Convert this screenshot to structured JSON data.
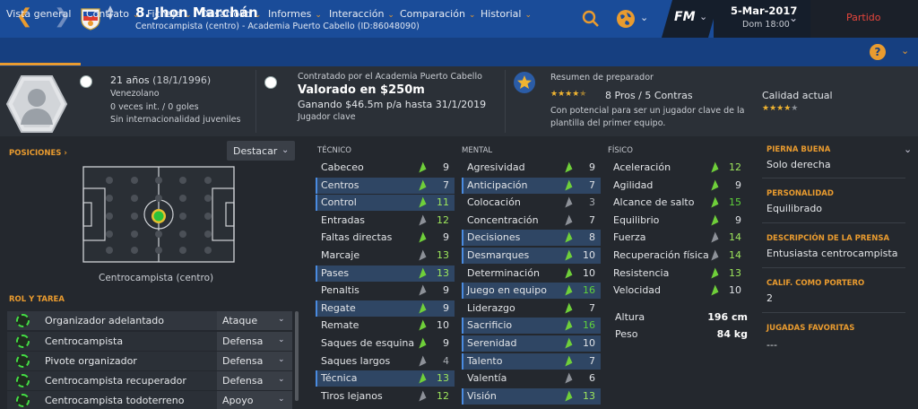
{
  "header": {
    "back_icon": "chevron-left-icon",
    "forward_icon": "chevron-right-icon",
    "title": "8. Jhon Marchán",
    "subtitle": "Centrocampista (centro) - Academia Puerto Cabello (ID:86048090)",
    "search_icon": "search-icon",
    "world_icon": "globe-icon",
    "fm_logo": "FM",
    "date": "5-Mar-2017",
    "time": "Dom 18:00",
    "match_button": "Partido"
  },
  "menu": {
    "items": [
      "Vista general",
      "Contrato",
      "Fichaje",
      "Desarrollo",
      "Informes",
      "Interacción",
      "Comparación",
      "Historial"
    ],
    "help": "?",
    "accent": "#e99b2f"
  },
  "profile": {
    "age": "21 años",
    "dob": "(18/1/1996)",
    "nationality": "Venezolano",
    "caps": "0 veces int. / 0 goles",
    "youth": "Sin internacionalidad juveniles"
  },
  "contract": {
    "signed_by": "Contratado por el Academia Puerto Cabello",
    "value": "Valorado en $250m",
    "wage": "Ganando $46.5m p/a hasta 31/1/2019",
    "status": "Jugador clave"
  },
  "scout": {
    "title": "Resumen de preparador",
    "pros_cons": "8 Pros / 5 Contras",
    "summary_line1": "Con potencial para ser un jugador clave de la",
    "summary_line2": "plantilla del primer equipo.",
    "potential_stars": 4,
    "current_label": "Calidad actual",
    "current_stars": 4
  },
  "positions": {
    "label": "POSICIONES",
    "highlight": "Destacar",
    "position": "Centrocampista (centro)"
  },
  "roles": {
    "label": "ROL Y TAREA",
    "items": [
      {
        "role": "Organizador adelantado",
        "duty": "Ataque"
      },
      {
        "role": "Centrocampista",
        "duty": "Defensa"
      },
      {
        "role": "Pivote organizador",
        "duty": "Defensa"
      },
      {
        "role": "Centrocampista recuperador",
        "duty": "Defensa"
      },
      {
        "role": "Centrocampista todoterreno",
        "duty": "Apoyo"
      }
    ]
  },
  "attributes": {
    "technical_label": "TÉCNICO",
    "mental_label": "MENTAL",
    "physical_label": "FÍSICO",
    "technical": [
      {
        "name": "Cabeceo",
        "value": 9
      },
      {
        "name": "Centros",
        "value": 7
      },
      {
        "name": "Control",
        "value": 11
      },
      {
        "name": "Entradas",
        "value": 12
      },
      {
        "name": "Faltas directas",
        "value": 9
      },
      {
        "name": "Marcaje",
        "value": 13
      },
      {
        "name": "Pases",
        "value": 13
      },
      {
        "name": "Penaltis",
        "value": 9
      },
      {
        "name": "Regate",
        "value": 9
      },
      {
        "name": "Remate",
        "value": 10
      },
      {
        "name": "Saques de esquina",
        "value": 9
      },
      {
        "name": "Saques largos",
        "value": 4
      },
      {
        "name": "Técnica",
        "value": 13
      },
      {
        "name": "Tiros lejanos",
        "value": 12
      }
    ],
    "mental": [
      {
        "name": "Agresividad",
        "value": 9
      },
      {
        "name": "Anticipación",
        "value": 7
      },
      {
        "name": "Colocación",
        "value": 3
      },
      {
        "name": "Concentración",
        "value": 7
      },
      {
        "name": "Decisiones",
        "value": 8
      },
      {
        "name": "Desmarques",
        "value": 10
      },
      {
        "name": "Determinación",
        "value": 10
      },
      {
        "name": "Juego en equipo",
        "value": 16
      },
      {
        "name": "Liderazgo",
        "value": 7
      },
      {
        "name": "Sacrificio",
        "value": 16
      },
      {
        "name": "Serenidad",
        "value": 10
      },
      {
        "name": "Talento",
        "value": 7
      },
      {
        "name": "Valentía",
        "value": 6
      },
      {
        "name": "Visión",
        "value": 13
      }
    ],
    "physical": [
      {
        "name": "Aceleración",
        "value": 12
      },
      {
        "name": "Agilidad",
        "value": 9
      },
      {
        "name": "Alcance de salto",
        "value": 15
      },
      {
        "name": "Equilibrio",
        "value": 9
      },
      {
        "name": "Fuerza",
        "value": 14
      },
      {
        "name": "Recuperación física",
        "value": 14
      },
      {
        "name": "Resistencia",
        "value": 13
      },
      {
        "name": "Velocidad",
        "value": 10
      }
    ],
    "height_label": "Altura",
    "height": "196 cm",
    "weight_label": "Peso",
    "weight": "84 kg"
  },
  "details": {
    "foot_label": "PIERNA BUENA",
    "foot": "Solo derecha",
    "personality_label": "PERSONALIDAD",
    "personality": "Equilibrado",
    "press_label": "DESCRIPCIÓN DE LA PRENSA",
    "press": "Entusiasta centrocampista",
    "gk_label": "CALIF. COMO PORTERO",
    "gk": "2",
    "moves_label": "JUGADAS FAVORITAS",
    "moves": "---"
  }
}
